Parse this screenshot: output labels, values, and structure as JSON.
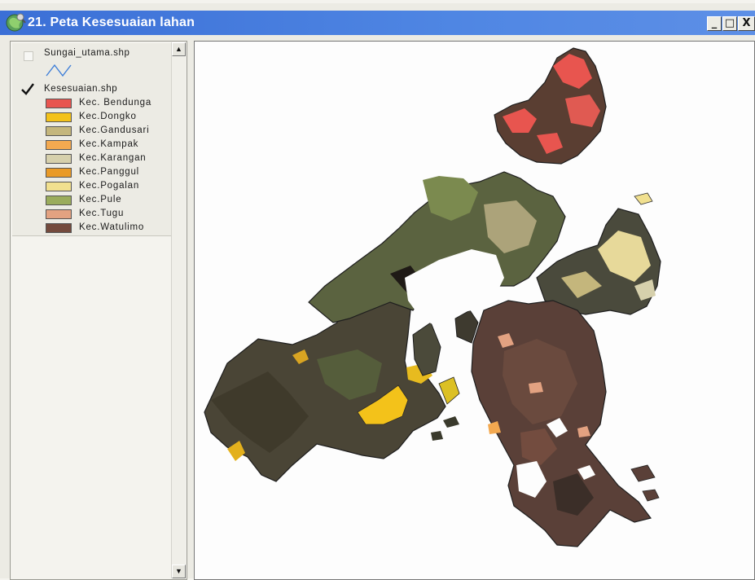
{
  "window": {
    "title": "21. Peta Kesesuaian lahan",
    "buttons": {
      "minimize": "_",
      "maximize": "□",
      "close": "X"
    }
  },
  "toc": {
    "layers": [
      {
        "name": "Sungai_utama.shp",
        "checked": false,
        "symbol": "line",
        "color": "#3f7fd8"
      },
      {
        "name": "Kesesuaian.shp",
        "checked": true
      }
    ],
    "legend": [
      {
        "label": "Kec. Bendunga",
        "color": "#e8554f"
      },
      {
        "label": "Kec.Dongko",
        "color": "#f3c21a"
      },
      {
        "label": "Kec.Gandusari",
        "color": "#c4b67c"
      },
      {
        "label": "Kec.Kampak",
        "color": "#f3a950"
      },
      {
        "label": "Kec.Karangan",
        "color": "#d6d0ac"
      },
      {
        "label": "Kec.Panggul",
        "color": "#e99a27"
      },
      {
        "label": "Kec.Pogalan",
        "color": "#f1e08f"
      },
      {
        "label": "Kec.Pule",
        "color": "#9aac5c"
      },
      {
        "label": "Kec.Tugu",
        "color": "#e3a281"
      },
      {
        "label": "Kec.Watulimo",
        "color": "#744a3d"
      }
    ]
  },
  "map": {
    "background": "#fdfdfd",
    "outline": "#232323"
  }
}
